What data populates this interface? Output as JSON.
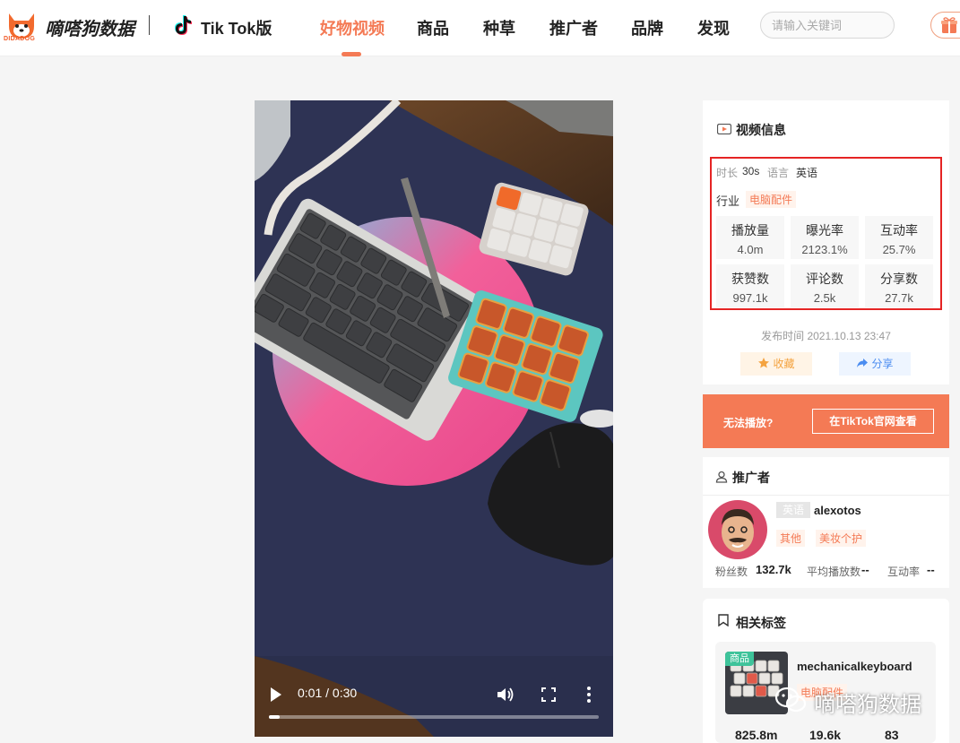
{
  "header": {
    "logo_sub": "DIDADOG",
    "brand": "嘀嗒狗数据",
    "platform": "Tik Tok版",
    "nav": [
      {
        "label": "好物视频",
        "active": true
      },
      {
        "label": "商品",
        "active": false
      },
      {
        "label": "种草",
        "active": false
      },
      {
        "label": "推广者",
        "active": false
      },
      {
        "label": "品牌",
        "active": false
      },
      {
        "label": "发现",
        "active": false
      }
    ],
    "search_placeholder": "请输入关键词",
    "accent_color": "#f47a55"
  },
  "video": {
    "time": "0:01 / 0:30",
    "progress": 0.033
  },
  "video_info": {
    "title": "视频信息",
    "duration_label": "时长",
    "duration": "30s",
    "language_label": "语言",
    "language": "英语",
    "industry_label": "行业",
    "industry": "电脑配件",
    "stats": [
      {
        "label": "播放量",
        "value": "4.0m"
      },
      {
        "label": "曝光率",
        "value": "2123.1%"
      },
      {
        "label": "互动率",
        "value": "25.7%"
      },
      {
        "label": "获赞数",
        "value": "997.1k"
      },
      {
        "label": "评论数",
        "value": "2.5k"
      },
      {
        "label": "分享数",
        "value": "27.7k"
      }
    ],
    "publish_time": "发布时间 2021.10.13 23:47",
    "fav_label": "收藏",
    "share_label": "分享"
  },
  "cant_play": {
    "label": "无法播放?",
    "button": "在TikTok官网查看"
  },
  "promoter": {
    "title": "推广者",
    "language": "英语",
    "name": "alexotos",
    "tags": [
      "其他",
      "美妆个护"
    ],
    "fans_label": "粉丝数",
    "fans": "132.7k",
    "avg_play_label": "平均播放数",
    "avg_play": "--",
    "interaction_label": "互动率",
    "interaction": "--"
  },
  "related_tags": {
    "title": "相关标签",
    "product_badge": "商品",
    "tag_name": "mechanicalkeyboard",
    "tag_category": "电脑配件",
    "stats": [
      "825.8m",
      "19.6k",
      "83"
    ]
  },
  "watermark": "嘀嗒狗数据"
}
